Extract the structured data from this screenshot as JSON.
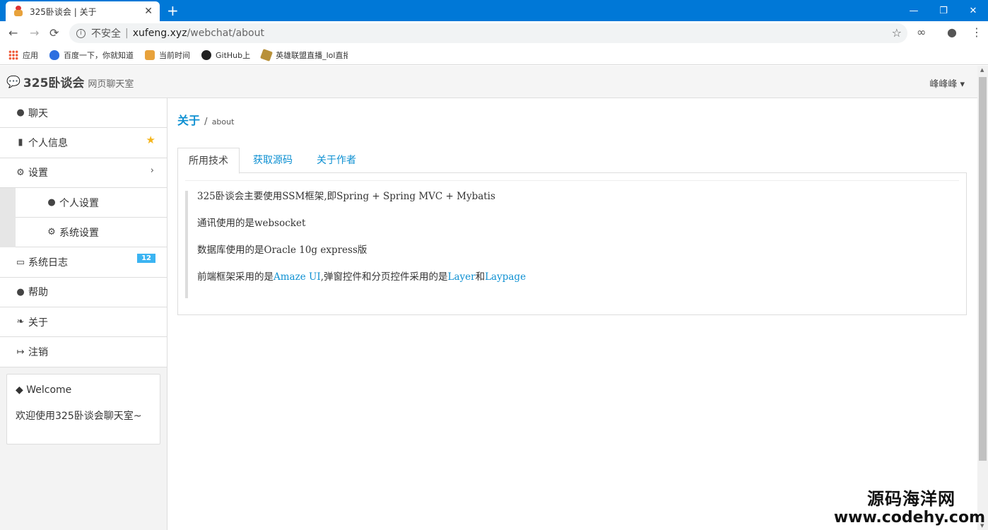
{
  "browser": {
    "tab_title": "325卧谈会 | 关于",
    "tab_close": "✕",
    "new_tab": "+",
    "window_buttons": [
      "—",
      "❐",
      "✕"
    ],
    "nav": {
      "back": "←",
      "forward": "→",
      "reload": "⟳"
    },
    "address": {
      "insecure_label": "不安全",
      "sep": "|",
      "host": "xufeng.xyz",
      "path": "/webchat/about"
    },
    "bookmarks": [
      {
        "label": "应用",
        "icon": "apps-icon"
      },
      {
        "label": "百度一下，你就知道",
        "icon": "baidu-icon"
      },
      {
        "label": "当前时间",
        "icon": "fox-icon"
      },
      {
        "label": "GitHub上",
        "icon": "github-icon"
      },
      {
        "label": "英雄联盟直播_lol直播",
        "icon": "lol-icon"
      }
    ]
  },
  "header": {
    "brand": "325卧谈会",
    "subtitle": "网页聊天室",
    "user": "峰峰峰 ▾"
  },
  "sidebar": {
    "items": [
      {
        "label": "聊天",
        "icon": "comment-icon"
      },
      {
        "label": "个人信息",
        "icon": "book-icon"
      },
      {
        "label": "设置",
        "icon": "cogs-icon"
      },
      {
        "label": "个人设置",
        "icon": "users-icon"
      },
      {
        "label": "系统设置",
        "icon": "cog-icon"
      },
      {
        "label": "系统日志",
        "icon": "inbox-icon",
        "badge": "12"
      },
      {
        "label": "帮助",
        "icon": "globe-icon"
      },
      {
        "label": "关于",
        "icon": "leaf-icon"
      },
      {
        "label": "注销",
        "icon": "sign-out-icon"
      }
    ],
    "welcome": {
      "title": "Welcome",
      "body": "欢迎使用325卧谈会聊天室~"
    }
  },
  "main": {
    "breadcrumb": {
      "title": "关于",
      "sub": "about"
    },
    "tabs": [
      "所用技术",
      "获取源码",
      "关于作者"
    ],
    "content": {
      "line1": "325卧谈会主要使用SSM框架,即Spring + Spring MVC + Mybatis",
      "line2": "通讯使用的是websocket",
      "line3": "数据库使用的是Oracle 10g express版",
      "line4_prefix": "前端框架采用的是",
      "line4_link1": "Amaze UI",
      "line4_mid": ",弹窗控件和分页控件采用的是",
      "line4_link2": "Layer",
      "line4_and": "和",
      "line4_link3": "Laypage"
    }
  },
  "watermark": {
    "line1": "源码海洋网",
    "line2": "www.codehy.com"
  },
  "colors": {
    "titlebar": "#0078d7",
    "link": "#0e90d2",
    "badge": "#3bb4f2",
    "star": "#f5b51b"
  }
}
